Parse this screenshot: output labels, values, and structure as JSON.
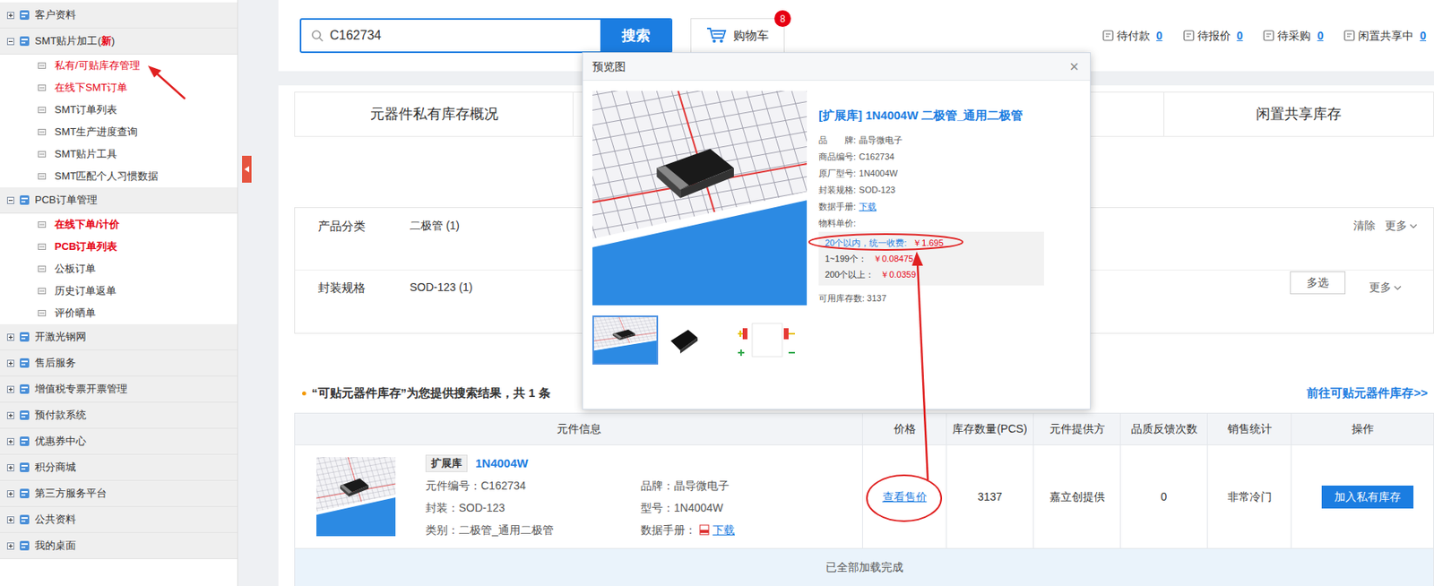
{
  "sidebar": {
    "groups": [
      {
        "label": "客户资料",
        "expanded": false,
        "items": []
      },
      {
        "label": "SMT贴片加工(",
        "tag": "新",
        "label_end": ")",
        "expanded": true,
        "items": [
          {
            "label": "私有/可贴库存管理",
            "kind": "red"
          },
          {
            "label": "在线下SMT订单",
            "kind": "red"
          },
          {
            "label": "SMT订单列表",
            "kind": "normal"
          },
          {
            "label": "SMT生产进度查询",
            "kind": "normal"
          },
          {
            "label": "SMT贴片工具",
            "kind": "normal"
          },
          {
            "label": "SMT匹配个人习惯数据",
            "kind": "normal"
          }
        ]
      },
      {
        "label": "PCB订单管理",
        "expanded": true,
        "items": [
          {
            "label": "在线下单/计价",
            "kind": "red-bold"
          },
          {
            "label": "PCB订单列表",
            "kind": "red-bold"
          },
          {
            "label": "公板订单",
            "kind": "normal"
          },
          {
            "label": "历史订单返单",
            "kind": "normal"
          },
          {
            "label": "评价晒单",
            "kind": "normal"
          }
        ]
      },
      {
        "label": "开激光钢网",
        "expanded": false,
        "items": []
      },
      {
        "label": "售后服务",
        "expanded": false,
        "items": []
      },
      {
        "label": "增值税专票开票管理",
        "expanded": false,
        "items": []
      },
      {
        "label": "预付款系统",
        "expanded": false,
        "items": []
      },
      {
        "label": "优惠券中心",
        "expanded": false,
        "items": []
      },
      {
        "label": "积分商城",
        "expanded": false,
        "items": []
      },
      {
        "label": "第三方服务平台",
        "expanded": false,
        "items": []
      },
      {
        "label": "公共资料",
        "expanded": false,
        "items": []
      },
      {
        "label": "我的桌面",
        "expanded": false,
        "items": []
      }
    ]
  },
  "header": {
    "search": {
      "value": "C162734",
      "button": "搜索"
    },
    "cart": {
      "label": "购物车",
      "badge": "8"
    },
    "stats": [
      {
        "label": "待付款",
        "count": "0"
      },
      {
        "label": "待报价",
        "count": "0"
      },
      {
        "label": "待采购",
        "count": "0"
      },
      {
        "label": "闲置共享中",
        "count": "0"
      }
    ]
  },
  "tabs": [
    {
      "label": "元器件私有库存概况",
      "selected": false
    },
    {
      "label": "闲置共享库存",
      "selected": false
    }
  ],
  "filters": [
    {
      "label": "产品分类",
      "value": "二极管 (1)",
      "clear": "清除",
      "more": "更多"
    },
    {
      "label": "封装规格",
      "value": "SOD-123 (1)",
      "button": "多选",
      "more": "更多"
    }
  ],
  "results": {
    "title": "“可贴元器件库存”为您提供搜索结果，共 1 条",
    "link": "前往可贴元器件库存>>"
  },
  "table": {
    "columns": [
      "元件信息",
      "价格",
      "库存数量(PCS)",
      "元件提供方",
      "品质反馈次数",
      "销售统计",
      "操作"
    ],
    "rows": [
      {
        "tag": "扩展库",
        "part": "1N4004W",
        "code": "元件编号：C162734",
        "package": "封装：SOD-123",
        "category": "类别：二极管_通用二极管",
        "brand": "品牌：晶导微电子",
        "model": "型号：1N4004W",
        "datasheet_label": "数据手册：",
        "datasheet_link": "下载",
        "price": "查看售价",
        "stock": "3137",
        "provider": "嘉立创提供",
        "feedback": "0",
        "sales": "非常冷门",
        "action": "加入私有库存"
      }
    ],
    "footer": "已全部加载完成"
  },
  "preview": {
    "title": "预览图",
    "close": "×",
    "product": "[扩展库] 1N4004W 二极管_通用二极管",
    "info": [
      {
        "label": "品　　牌:",
        "value": "晶导微电子",
        "kind": "text"
      },
      {
        "label": "商品编号:",
        "value": "C162734",
        "kind": "text"
      },
      {
        "label": "原厂型号:",
        "value": "1N4004W",
        "kind": "text"
      },
      {
        "label": "封装规格:",
        "value": "SOD-123",
        "kind": "text"
      },
      {
        "label": "数据手册:",
        "value": "下载",
        "kind": "link"
      }
    ],
    "price_label": "物料单价:",
    "tiers": [
      {
        "label": "20个以内，统一收费:",
        "price": "￥1.695",
        "selected": true
      },
      {
        "label": "1~199个：",
        "price": "￥0.08475",
        "selected": false
      },
      {
        "label": "200个以上：",
        "price": "￥0.0359",
        "selected": false
      }
    ],
    "stock": "可用库存数: 3137",
    "thumbnails": [
      {
        "kind": "photo",
        "selected": true
      },
      {
        "kind": "chip",
        "selected": false
      },
      {
        "kind": "symbol",
        "selected": false
      }
    ]
  }
}
